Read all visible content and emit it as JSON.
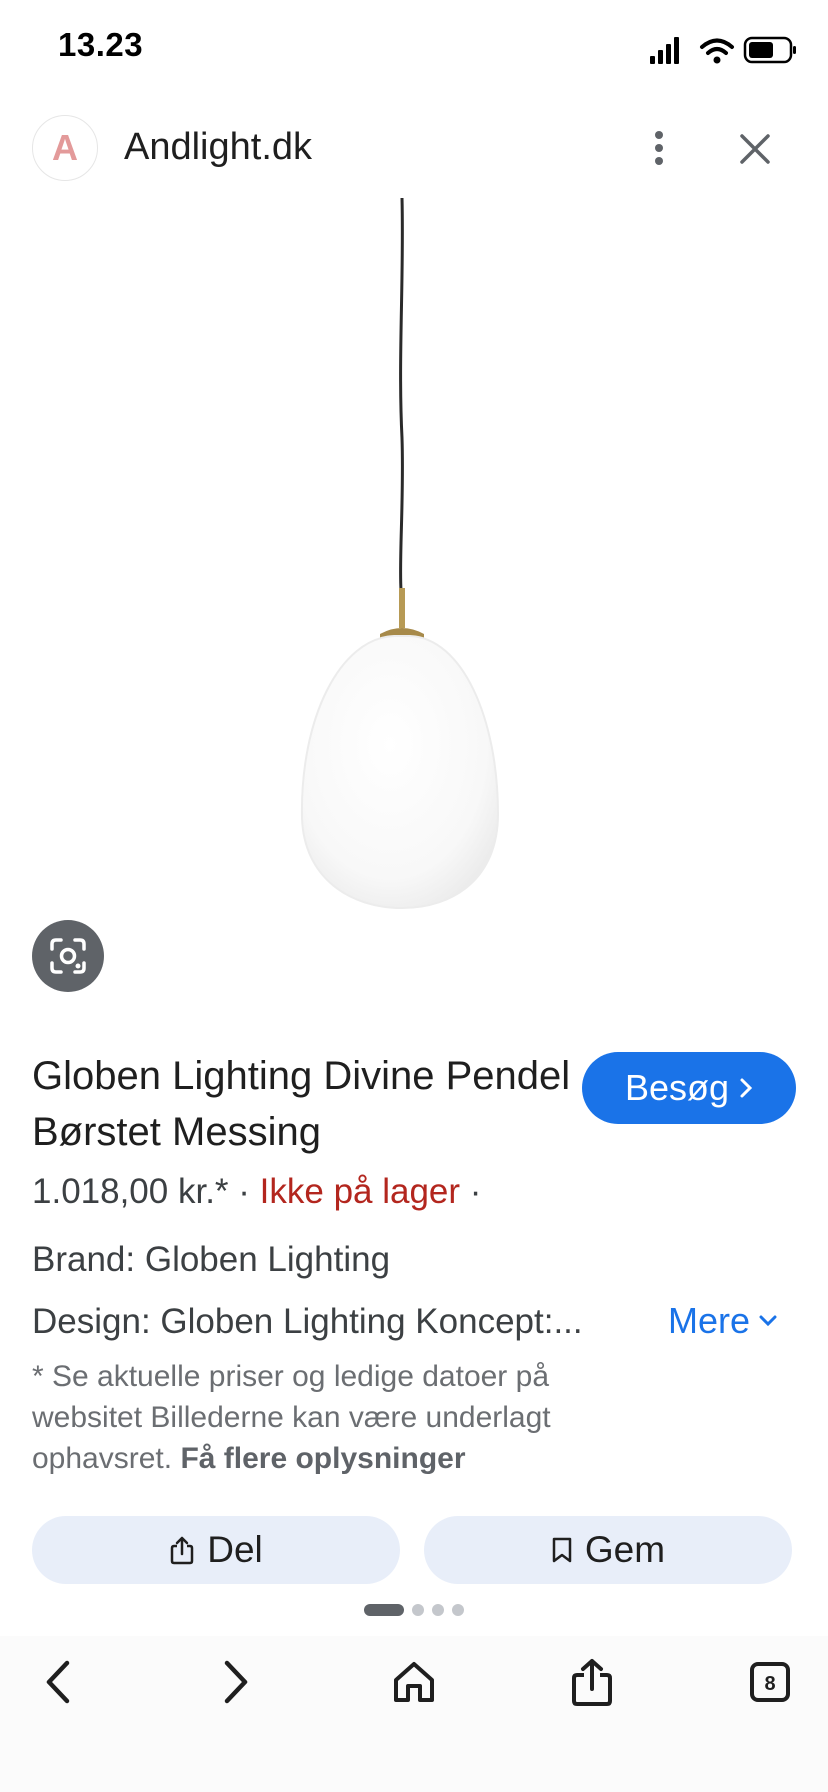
{
  "status_bar": {
    "time": "13.23",
    "icons": [
      "signal-icon",
      "wifi-icon",
      "battery-icon"
    ]
  },
  "header": {
    "logo_letter": "A",
    "site_name": "Andlight.dk"
  },
  "product": {
    "title": "Globen Lighting Divine Pendel Børstet Messing",
    "visit_label": "Besøg",
    "price": "1.018,00 kr.*",
    "separator": " · ",
    "stock_status": "Ikke på lager",
    "trailing_separator": " ·",
    "brand": "Brand: Globen Lighting",
    "design": "Design: Globen Lighting Koncept:...",
    "more_label": "Mere",
    "disclaimer": "* Se aktuelle priser og ledige datoer på websitet Billederne kan være underlagt ophavsret.",
    "disclaimer_link": "Få flere oplysninger"
  },
  "actions": {
    "share_label": "Del",
    "save_label": "Gem"
  },
  "pager": {
    "count": 4,
    "active": 0
  },
  "toolbar": {
    "tab_count": "8"
  },
  "colors": {
    "accent": "#1a73e8",
    "stock": "#b3261e",
    "action_bg": "#e8eef9"
  }
}
